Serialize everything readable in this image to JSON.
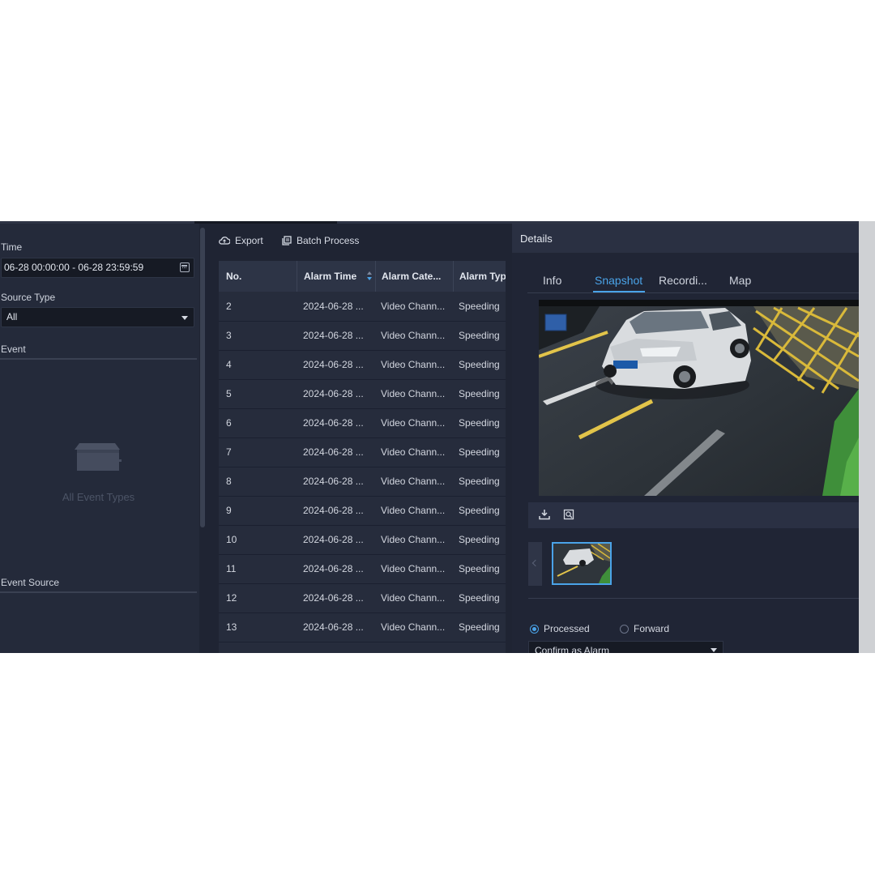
{
  "filters": {
    "time_label": "Time",
    "time_value": "06-28 00:00:00 - 06-28 23:59:59",
    "source_type_label": "Source Type",
    "source_type_value": "All",
    "event_label": "Event",
    "event_empty_text": "All Event Types",
    "event_source_label": "Event Source"
  },
  "toolbar": {
    "export_label": "Export",
    "batch_label": "Batch Process"
  },
  "table": {
    "headers": [
      "No.",
      "Alarm Time",
      "Alarm Cate...",
      "Alarm Typ"
    ],
    "rows": [
      {
        "no": "2",
        "time": "2024-06-28 ...",
        "category": "Video Chann...",
        "type": "Speeding"
      },
      {
        "no": "3",
        "time": "2024-06-28 ...",
        "category": "Video Chann...",
        "type": "Speeding"
      },
      {
        "no": "4",
        "time": "2024-06-28 ...",
        "category": "Video Chann...",
        "type": "Speeding"
      },
      {
        "no": "5",
        "time": "2024-06-28 ...",
        "category": "Video Chann...",
        "type": "Speeding"
      },
      {
        "no": "6",
        "time": "2024-06-28 ...",
        "category": "Video Chann...",
        "type": "Speeding"
      },
      {
        "no": "7",
        "time": "2024-06-28 ...",
        "category": "Video Chann...",
        "type": "Speeding"
      },
      {
        "no": "8",
        "time": "2024-06-28 ...",
        "category": "Video Chann...",
        "type": "Speeding"
      },
      {
        "no": "9",
        "time": "2024-06-28 ...",
        "category": "Video Chann...",
        "type": "Speeding"
      },
      {
        "no": "10",
        "time": "2024-06-28 ...",
        "category": "Video Chann...",
        "type": "Speeding"
      },
      {
        "no": "11",
        "time": "2024-06-28 ...",
        "category": "Video Chann...",
        "type": "Speeding"
      },
      {
        "no": "12",
        "time": "2024-06-28 ...",
        "category": "Video Chann...",
        "type": "Speeding"
      },
      {
        "no": "13",
        "time": "2024-06-28 ...",
        "category": "Video Chann...",
        "type": "Speeding"
      }
    ]
  },
  "details": {
    "title": "Details",
    "tabs": [
      "Info",
      "Snapshot",
      "Recordi...",
      "Map"
    ],
    "active_tab": "Snapshot",
    "radio_processed": "Processed",
    "radio_forward": "Forward",
    "processed_selected": true,
    "process_option": "Confirm as Alarm"
  },
  "icons": {
    "export": "cloud-export-icon",
    "batch": "batch-process-icon",
    "calendar": "calendar-icon",
    "download": "download-icon",
    "zoom": "zoom-icon",
    "empty": "empty-box-icon"
  },
  "colors": {
    "accent": "#4aa3e8",
    "background": "#1f2433",
    "panel": "#242a3a"
  }
}
